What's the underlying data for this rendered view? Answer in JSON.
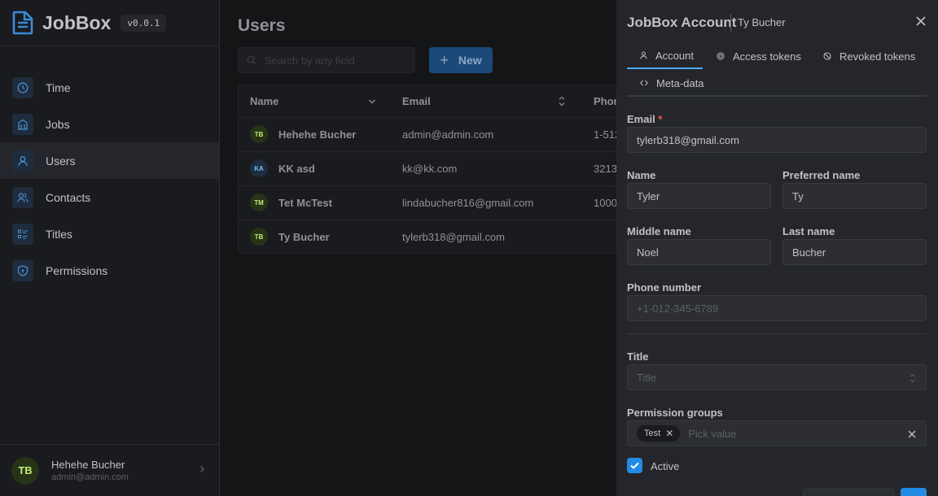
{
  "app": {
    "name": "JobBox",
    "version": "v0.0.1"
  },
  "sidebar": {
    "items": [
      {
        "label": "Time",
        "icon": "clock-icon"
      },
      {
        "label": "Jobs",
        "icon": "building-icon"
      },
      {
        "label": "Users",
        "icon": "user-icon",
        "active": true
      },
      {
        "label": "Contacts",
        "icon": "users-icon"
      },
      {
        "label": "Titles",
        "icon": "list-icon"
      },
      {
        "label": "Permissions",
        "icon": "shield-icon"
      }
    ],
    "current_user": {
      "initials": "TB",
      "name": "Hehehe Bucher",
      "email": "admin@admin.com"
    }
  },
  "main": {
    "title": "Users",
    "search_placeholder": "Search by any field",
    "new_button": "New",
    "columns": [
      "Name",
      "Email",
      "Phon"
    ],
    "rows": [
      {
        "initials": "TB",
        "name": "Hehehe Bucher",
        "email": "admin@admin.com",
        "phone": "1-512",
        "avatar": "green"
      },
      {
        "initials": "KA",
        "name": "KK asd",
        "email": "kk@kk.com",
        "phone": "3213",
        "avatar": "blue"
      },
      {
        "initials": "TM",
        "name": "Tet McTest",
        "email": "lindabucher816@gmail.com",
        "phone": "1000",
        "avatar": "green"
      },
      {
        "initials": "TB",
        "name": "Ty Bucher",
        "email": "tylerb318@gmail.com",
        "phone": "",
        "avatar": "green"
      }
    ]
  },
  "drawer": {
    "title": "JobBox Account",
    "subtitle": "Ty Bucher",
    "tabs": [
      "Account",
      "Access tokens",
      "Revoked tokens",
      "Meta-data"
    ],
    "fields": {
      "email_label": "Email",
      "email_required": "*",
      "email_value": "tylerb318@gmail.com",
      "name_label": "Name",
      "name_value": "Tyler",
      "preferred_label": "Preferred name",
      "preferred_value": "Ty",
      "middle_label": "Middle name",
      "middle_value": "Noel",
      "last_label": "Last name",
      "last_value": "Bucher",
      "phone_label": "Phone number",
      "phone_placeholder": "+1-012-345-6789",
      "title_label": "Title",
      "title_placeholder": "Title",
      "perm_label": "Permission groups",
      "perm_chip": "Test",
      "perm_placeholder": "Pick value",
      "active_label": "Active"
    }
  },
  "colors": {
    "accent": "#228be6",
    "active_tab": "#4dabf7",
    "avatar_green": "#c0eb75",
    "avatar_blue": "#74c0fc"
  }
}
